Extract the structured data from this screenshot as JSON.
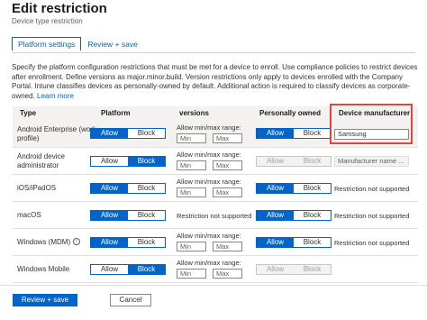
{
  "header": {
    "title": "Edit restriction",
    "subtitle": "Device type restriction"
  },
  "tabs": [
    {
      "label": "Platform settings",
      "active": true
    },
    {
      "label": "Review + save",
      "active": false
    }
  ],
  "description": {
    "text": "Specify the platform configuration restrictions that must be met for a device to enroll. Use compliance policies to restrict devices after enrollment. Define versions as major.minor.build. Version restrictions only apply to devices enrolled with the Company Portal. Intune classifies devices as personally-owned by default. Additional action is required to classify devices as corporate-owned.",
    "link": "Learn more"
  },
  "table": {
    "headers": {
      "type": "Type",
      "platform": "Platform",
      "versions": "versions",
      "personally_owned": "Personally owned",
      "device_manufacturer": "Device manufacturer"
    },
    "toggle_labels": {
      "allow": "Allow",
      "block": "Block"
    },
    "version_label": "Allow min/max range:",
    "min_placeholder": "Min",
    "max_placeholder": "Max",
    "restriction_not_supported": "Restriction not supported",
    "rows": [
      {
        "type": "Android Enterprise (work profile)",
        "platform": "Allow",
        "personally_owned": "Allow",
        "manufacturer_value": "Samsung"
      },
      {
        "type": "Android device administrator",
        "platform": "Block",
        "personally_owned": "Allow",
        "manufacturer_placeholder": "Manufacturer name ..."
      },
      {
        "type": "iOS/iPadOS",
        "platform": "Allow",
        "personally_owned": "Allow"
      },
      {
        "type": "macOS",
        "platform": "Allow",
        "personally_owned": "Allow"
      },
      {
        "type": "Windows (MDM)",
        "platform": "Allow",
        "personally_owned": "Allow"
      },
      {
        "type": "Windows Mobile",
        "platform": "Block",
        "personally_owned": "Allow"
      }
    ]
  },
  "footer": {
    "primary": "Review + save",
    "secondary": "Cancel"
  },
  "colors": {
    "accent": "#0064c8",
    "highlight_border": "#e0463b"
  }
}
